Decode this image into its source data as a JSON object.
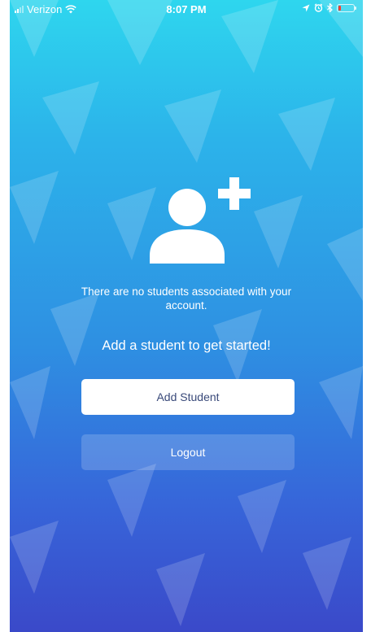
{
  "status_bar": {
    "carrier": "Verizon",
    "time": "8:07 PM"
  },
  "empty_state": {
    "message": "There are no students associated with your account.",
    "cta": "Add a student to get started!"
  },
  "buttons": {
    "add_student": "Add Student",
    "logout": "Logout"
  },
  "icons": [
    "signal-icon",
    "wifi-icon",
    "location-icon",
    "alarm-icon",
    "bluetooth-icon",
    "battery-icon",
    "add-user-icon"
  ],
  "colors": {
    "gradient_top": "#2ed6ee",
    "gradient_bottom": "#3a49c9",
    "battery_low": "#ff3b30",
    "primary_button_text": "#3a4a7a"
  }
}
